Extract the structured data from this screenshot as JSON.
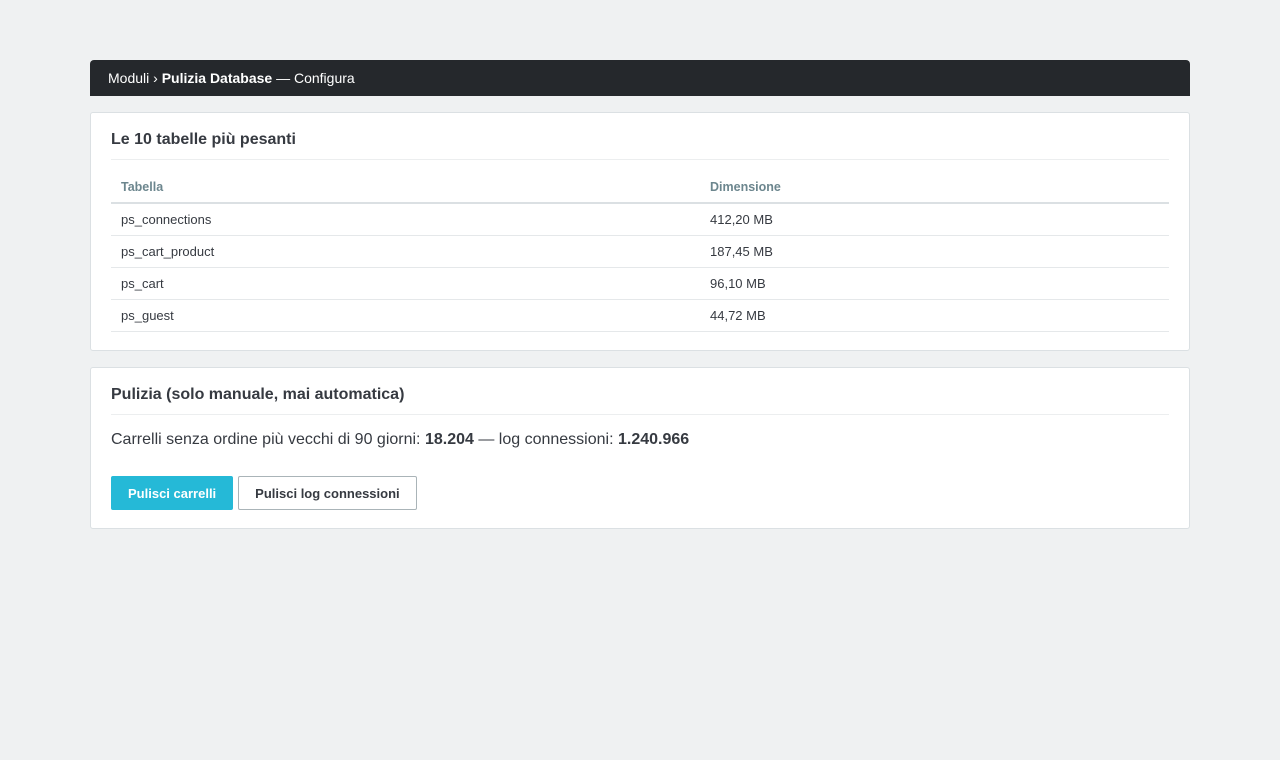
{
  "breadcrumb": {
    "root": "Moduli",
    "separator": "›",
    "current": "Pulizia Database",
    "suffix": "— Configura"
  },
  "tables_panel": {
    "title": "Le 10 tabelle più pesanti",
    "columns": [
      "Tabella",
      "Dimensione"
    ],
    "rows": [
      {
        "name": "ps_connections",
        "size": "412,20 MB"
      },
      {
        "name": "ps_cart_product",
        "size": "187,45 MB"
      },
      {
        "name": "ps_cart",
        "size": "96,10 MB"
      },
      {
        "name": "ps_guest",
        "size": "44,72 MB"
      }
    ]
  },
  "cleanup_panel": {
    "title": "Pulizia (solo manuale, mai automatica)",
    "carts_label": "Carrelli senza ordine più vecchi di 90 giorni:",
    "carts_count": "18.204",
    "log_label": "— log connessioni:",
    "log_count": "1.240.966",
    "clean_carts_button": "Pulisci carrelli",
    "clean_logs_button": "Pulisci log connessioni"
  },
  "colors": {
    "header_bg": "#25282c",
    "primary": "#25b9d7",
    "page_bg": "#eff1f2"
  }
}
